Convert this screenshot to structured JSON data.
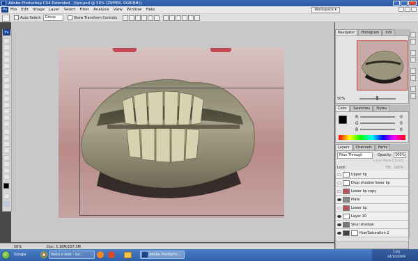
{
  "title_bar": {
    "text": "Adobe Photoshop CS4 Extended - [lips.psd @ 50% (ZIPPER, RGB/8#)]"
  },
  "menu": {
    "logo": "Ps",
    "items": [
      "File",
      "Edit",
      "Image",
      "Layer",
      "Select",
      "Filter",
      "Analysis",
      "View",
      "Window",
      "Help"
    ],
    "workspace": "Workspace ▾"
  },
  "options_bar": {
    "auto_select_label": "Auto-Select:",
    "auto_select_value": "Group",
    "show_transform_label": "Show Transform Controls"
  },
  "status_bar": {
    "zoom": "50%",
    "doc": "Doc: 5.16M/107.3M"
  },
  "navigator": {
    "tabs": [
      "Navigator",
      "Histogram",
      "Info"
    ],
    "zoom": "50%"
  },
  "color_panel": {
    "tabs": [
      "Color",
      "Swatches",
      "Styles"
    ],
    "channels": [
      {
        "label": "R",
        "value": "0"
      },
      {
        "label": "G",
        "value": "0"
      },
      {
        "label": "B",
        "value": "0"
      }
    ]
  },
  "layers_panel": {
    "tabs": [
      "Layers",
      "Channels",
      "Paths"
    ],
    "blend_mode": "Pass Through",
    "opacity_label": "Opacity:",
    "opacity_value": "100%",
    "mask_density_label": "Layer Mask Density",
    "lock_label": "Lock:",
    "fill_label": "Fill:",
    "fill_value": "100%",
    "layers": [
      {
        "name": "Upper lip",
        "visible": false
      },
      {
        "name": "Drop shadow lower lip",
        "visible": false
      },
      {
        "name": "Lower lip copy",
        "visible": false
      },
      {
        "name": "Plate",
        "visible": true
      },
      {
        "name": "Lower lip",
        "visible": false
      },
      {
        "name": "Layer 10",
        "visible": true
      },
      {
        "name": "Skull shadow",
        "visible": true
      },
      {
        "name": "Hue/Saturation 2",
        "visible": true
      }
    ]
  },
  "taskbar": {
    "items": [
      "Google",
      "Testo e web - Go...",
      "Adobe Photosho..."
    ],
    "time": "1:24",
    "date": "24/10/2009"
  }
}
